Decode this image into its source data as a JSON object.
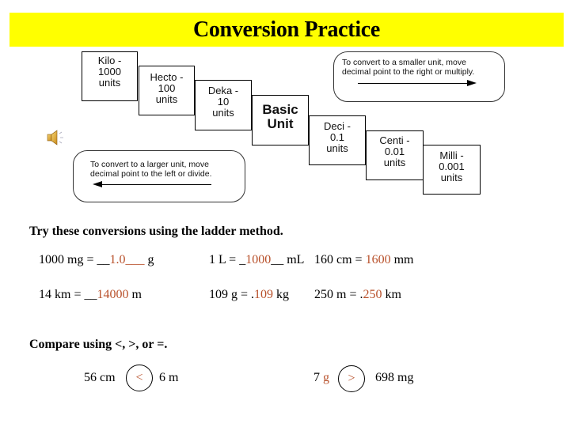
{
  "title": "Conversion Practice",
  "ladder": {
    "steps": [
      {
        "name": "Kilo -",
        "value": "1000",
        "unit": "units"
      },
      {
        "name": "Hecto -",
        "value": "100",
        "unit": "units"
      },
      {
        "name": "Deka -",
        "value": "10",
        "unit": "units"
      },
      {
        "name": "Basic",
        "value": "Unit",
        "unit": ""
      },
      {
        "name": "Deci -",
        "value": "0.1",
        "unit": "units"
      },
      {
        "name": "Centi -",
        "value": "0.01",
        "unit": "units"
      },
      {
        "name": "Milli -",
        "value": "0.001",
        "unit": "units"
      }
    ],
    "note_smaller": {
      "line1": "To convert to a smaller unit, move",
      "line2": "decimal  point to the right or multiply."
    },
    "note_larger": {
      "line1": "To convert to a larger unit, move",
      "line2": "decimal  point to the left or divide."
    }
  },
  "audio_icon": "speaker-icon",
  "colors": {
    "title_bg": "#ffff00",
    "answer": "#b8502a"
  },
  "conversions": {
    "heading": "Try these conversions using the ladder method.",
    "items": [
      {
        "prefix": "1000 mg = __",
        "answer": "1.0___",
        "suffix": " g"
      },
      {
        "prefix": "1 L = _",
        "answer": "1000",
        "suffix": "__ mL"
      },
      {
        "prefix": "160 cm = ",
        "answer": "1600",
        "suffix": " mm"
      },
      {
        "prefix": "14 km = __",
        "answer": "14000",
        "suffix": " m"
      },
      {
        "prefix": "109 g = .",
        "answer": "109",
        "suffix": " kg"
      },
      {
        "prefix": "250 m = .",
        "answer": "250",
        "suffix": " km"
      }
    ]
  },
  "compare": {
    "heading": "Compare using <, >, or =.",
    "items": [
      {
        "left": "56 cm",
        "left_unit": "",
        "symbol": "<",
        "right": "6 m"
      },
      {
        "left": "7 ",
        "left_unit": "g",
        "symbol": ">",
        "right": "698 mg"
      }
    ]
  }
}
